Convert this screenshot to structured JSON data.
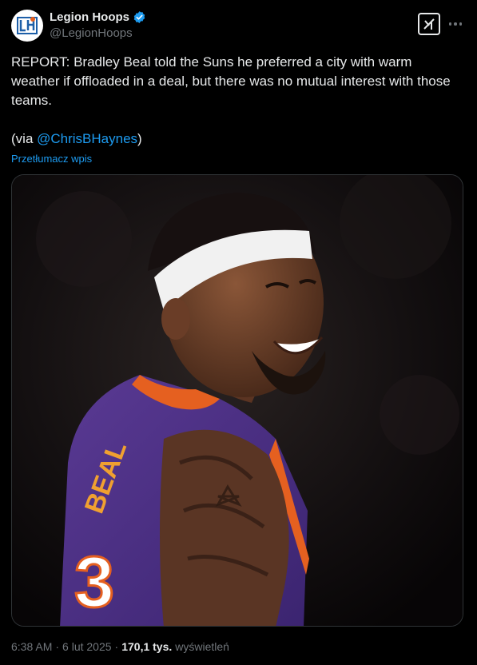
{
  "author": {
    "display_name": "Legion Hoops",
    "handle": "@LegionHoops",
    "verified": true,
    "avatar_icon": "legion-hoops-logo"
  },
  "header": {
    "grok_icon": "grok-icon",
    "more_icon": "more-dots-icon"
  },
  "tweet": {
    "text_line": "REPORT: Bradley Beal told the Suns he preferred a city with warm weather if offloaded in a deal, but there was no mutual interest with those teams.",
    "via_prefix": "(via ",
    "via_mention": "@ChrisBHaynes",
    "via_suffix": ")",
    "translate_label": "Przetłumacz wpis"
  },
  "media": {
    "jersey_name": "BEAL",
    "jersey_number": "3"
  },
  "footer": {
    "time": "6:38 AM",
    "date": "6 lut 2025",
    "separator": "·",
    "views_count": "170,1 tys.",
    "views_label": "wyświetleń"
  },
  "colors": {
    "background": "#000000",
    "text": "#e7e9ea",
    "muted": "#71767b",
    "link": "#1d9bf0",
    "verified": "#1d9bf0",
    "jersey_purple": "#4b2e83",
    "jersey_orange": "#e56020"
  }
}
